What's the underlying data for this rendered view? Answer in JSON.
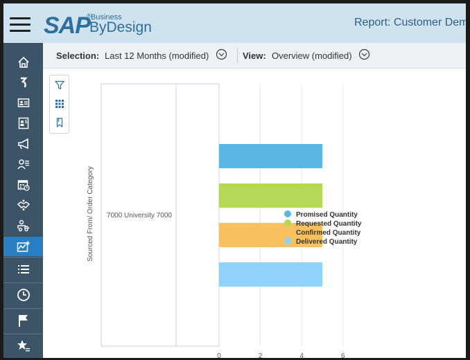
{
  "header": {
    "logo": {
      "brand": "SAP",
      "registered": "®",
      "business": "Business",
      "product": "ByDesign"
    },
    "report_title": "Report: Customer Demand Forecast"
  },
  "sidebar": {
    "items": [
      {
        "name": "home-icon"
      },
      {
        "name": "refresh-arrow-icon"
      },
      {
        "name": "contact-card-icon"
      },
      {
        "name": "document-dollar-icon"
      },
      {
        "name": "megaphone-icon"
      },
      {
        "name": "person-list-icon"
      },
      {
        "name": "calendar-clock-icon"
      },
      {
        "name": "handshake-icon"
      },
      {
        "name": "delivery-truck-icon"
      },
      {
        "name": "analytics-chart-icon",
        "active": true
      }
    ],
    "bottom": [
      {
        "name": "list-icon"
      },
      {
        "name": "clock-icon"
      },
      {
        "name": "flag-icon"
      },
      {
        "name": "star-list-icon"
      }
    ]
  },
  "toolbar": {
    "selection_label": "Selection:",
    "selection_value": "Last 12 Months (modified)",
    "view_label": "View:",
    "view_value": "Overview (modified)"
  },
  "tools": [
    "filter-icon",
    "grid-icon",
    "bookmark-icon"
  ],
  "chart_data": {
    "type": "bar",
    "orientation": "horizontal",
    "ylabel": "Sourced From/ Order Category",
    "categories": [
      "7000 University 7000"
    ],
    "x_ticks": [
      0,
      2,
      4,
      6
    ],
    "xlim": [
      0,
      6.5
    ],
    "series": [
      {
        "name": "Promised Quantity",
        "values": [
          5
        ],
        "color": "#5ab7e3"
      },
      {
        "name": "Requested Quantity",
        "values": [
          5
        ],
        "color": "#b5d957"
      },
      {
        "name": "Confirmed Quantity",
        "values": [
          5
        ],
        "color": "#f8c160"
      },
      {
        "name": "Delivered Quantity",
        "values": [
          5
        ],
        "color": "#8fd3fa"
      }
    ],
    "legend_position": "right",
    "grid": true
  }
}
